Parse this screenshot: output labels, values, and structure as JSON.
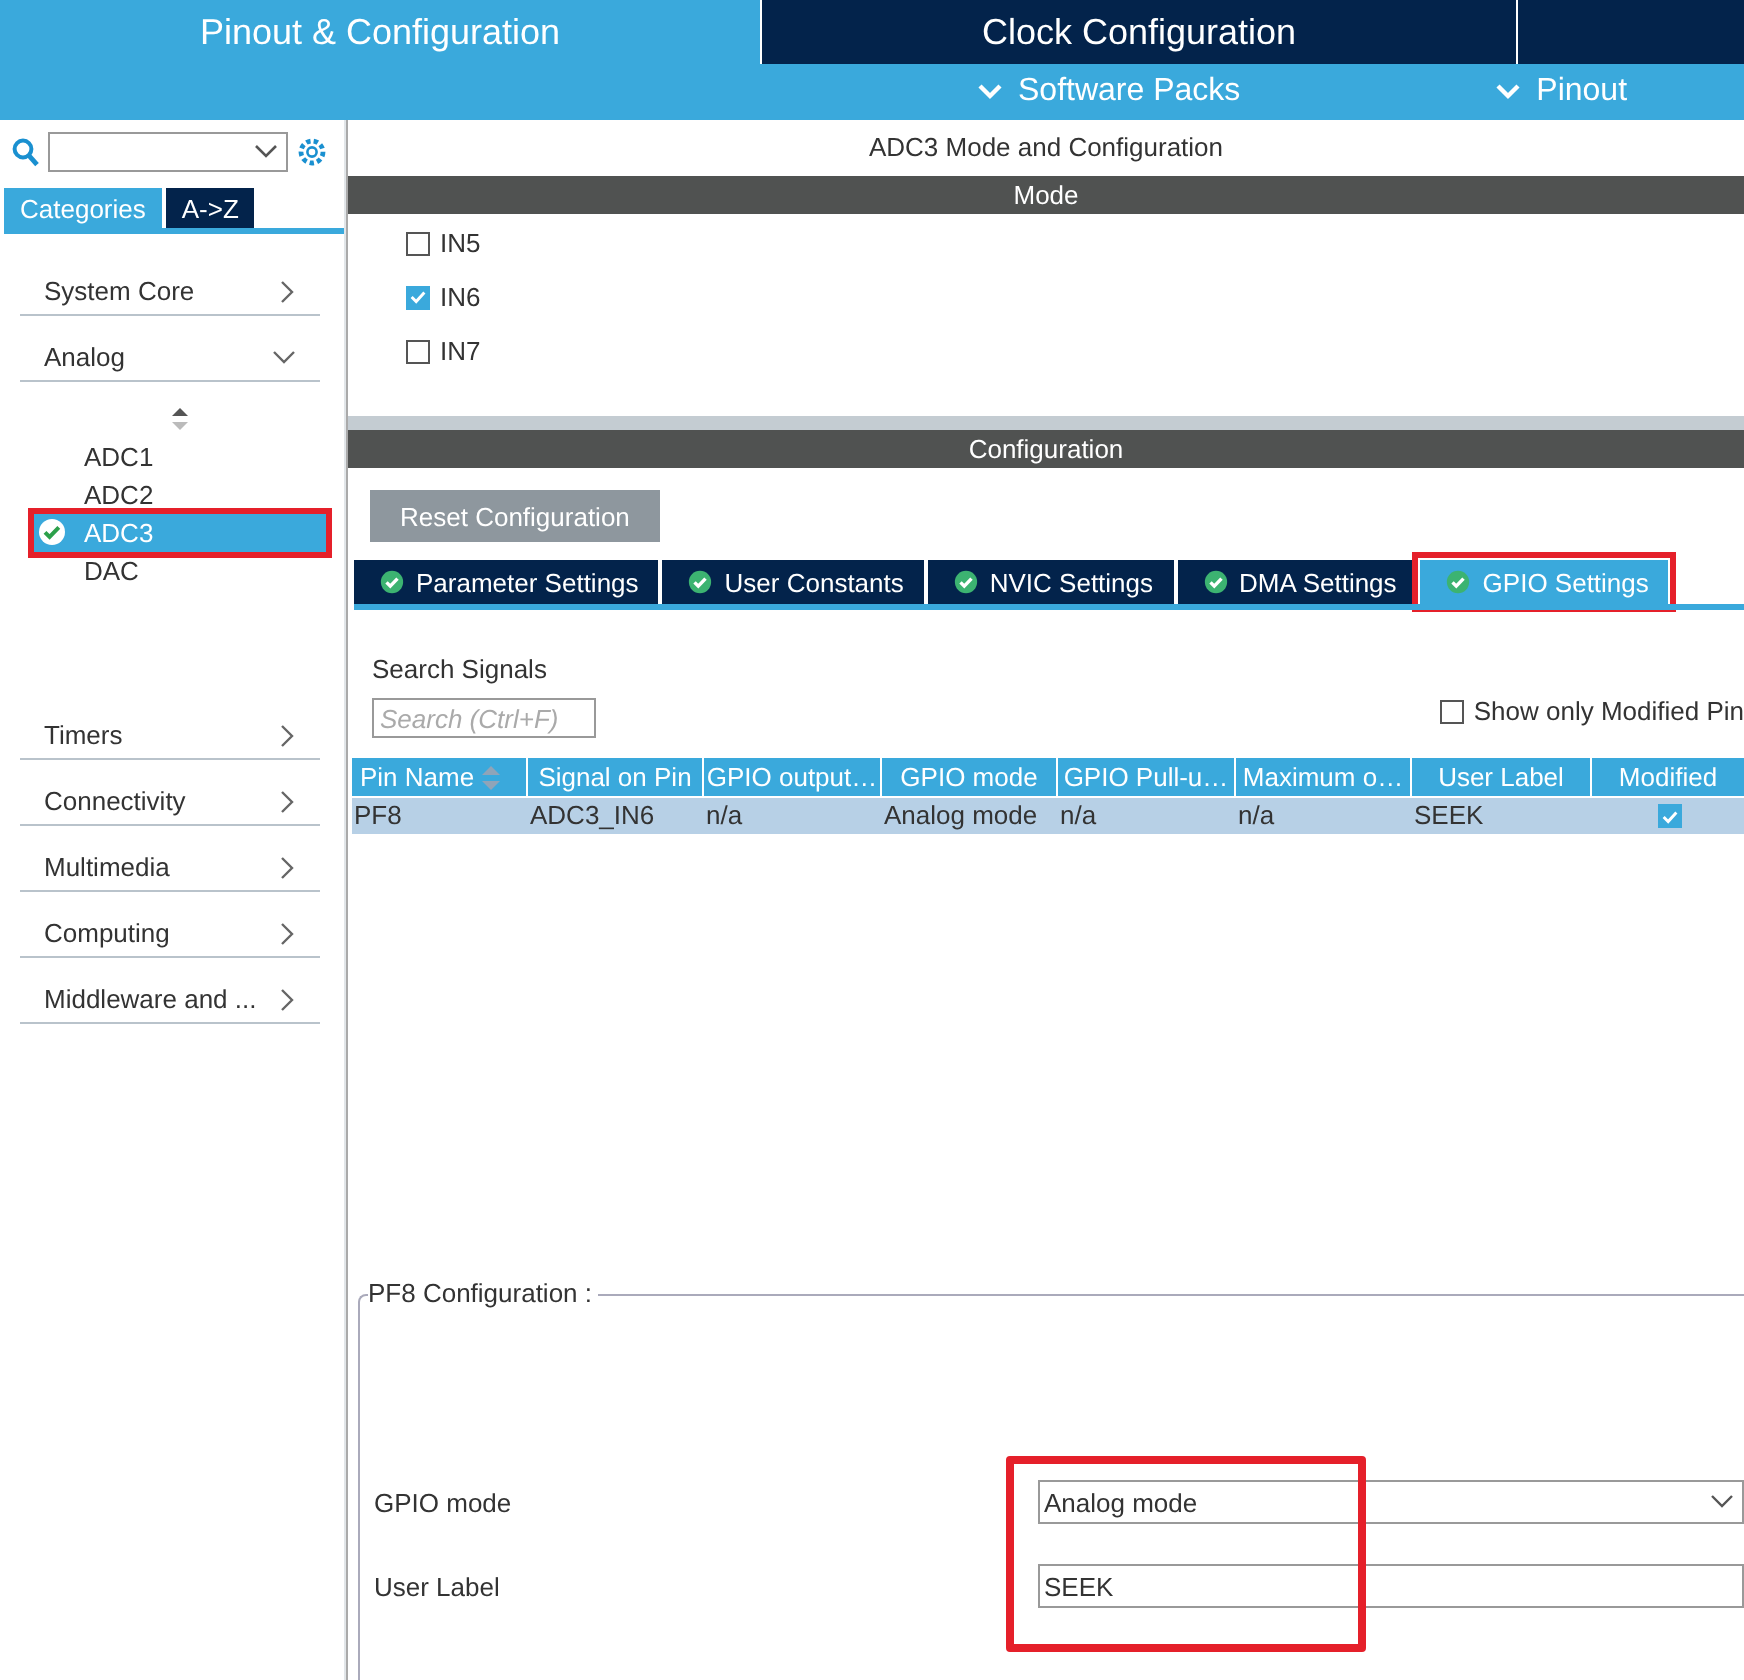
{
  "header": {
    "tabs": [
      {
        "label": "Pinout & Configuration",
        "selected": true
      },
      {
        "label": "Clock Configuration",
        "selected": false
      }
    ],
    "menus": [
      "Software Packs",
      "Pinout"
    ]
  },
  "sidebar": {
    "view_tabs": [
      {
        "label": "Categories",
        "selected": true
      },
      {
        "label": "A->Z",
        "selected": false
      }
    ],
    "categories": [
      {
        "label": "System Core",
        "expanded": false
      },
      {
        "label": "Analog",
        "expanded": true,
        "children": [
          {
            "label": "ADC1",
            "selected": false,
            "configured": false,
            "highlighted": false
          },
          {
            "label": "ADC2",
            "selected": false,
            "configured": false,
            "highlighted": false
          },
          {
            "label": "ADC3",
            "selected": true,
            "configured": true,
            "highlighted": true
          },
          {
            "label": "DAC",
            "selected": false,
            "configured": false,
            "highlighted": false
          }
        ]
      },
      {
        "label": "Timers",
        "expanded": false
      },
      {
        "label": "Connectivity",
        "expanded": false
      },
      {
        "label": "Multimedia",
        "expanded": false
      },
      {
        "label": "Computing",
        "expanded": false
      },
      {
        "label": "Middleware and ...",
        "expanded": false
      }
    ]
  },
  "panel": {
    "title": "ADC3 Mode and Configuration",
    "mode_header": "Mode",
    "channels": [
      {
        "label": "IN5",
        "checked": false
      },
      {
        "label": "IN6",
        "checked": true
      },
      {
        "label": "IN7",
        "checked": false
      }
    ],
    "config_header": "Configuration",
    "reset_button": "Reset Configuration",
    "tabs": [
      {
        "label": "Parameter Settings",
        "selected": false,
        "highlighted": false
      },
      {
        "label": "User Constants",
        "selected": false,
        "highlighted": false
      },
      {
        "label": "NVIC Settings",
        "selected": false,
        "highlighted": false
      },
      {
        "label": "DMA Settings",
        "selected": false,
        "highlighted": false
      },
      {
        "label": "GPIO Settings",
        "selected": true,
        "highlighted": true
      }
    ],
    "search_label": "Search Signals",
    "search_placeholder": "Search (Ctrl+F)",
    "modified_filter": {
      "label": "Show only Modified Pin",
      "checked": false
    },
    "table": {
      "columns": [
        "Pin Name",
        "Signal on Pin",
        "GPIO output…",
        "GPIO mode",
        "GPIO Pull-u…",
        "Maximum o…",
        "User Label",
        "Modified"
      ],
      "rows": [
        {
          "cells": [
            "PF8",
            "ADC3_IN6",
            "n/a",
            "Analog mode",
            "n/a",
            "n/a",
            "SEEK"
          ],
          "modified": true,
          "selected": true
        }
      ]
    },
    "pin_config": {
      "legend": "PF8 Configuration :",
      "highlighted": true,
      "fields": [
        {
          "kind": "select",
          "label": "GPIO mode",
          "value": "Analog mode"
        },
        {
          "kind": "text",
          "label": "User Label",
          "value": "SEEK"
        }
      ]
    }
  }
}
